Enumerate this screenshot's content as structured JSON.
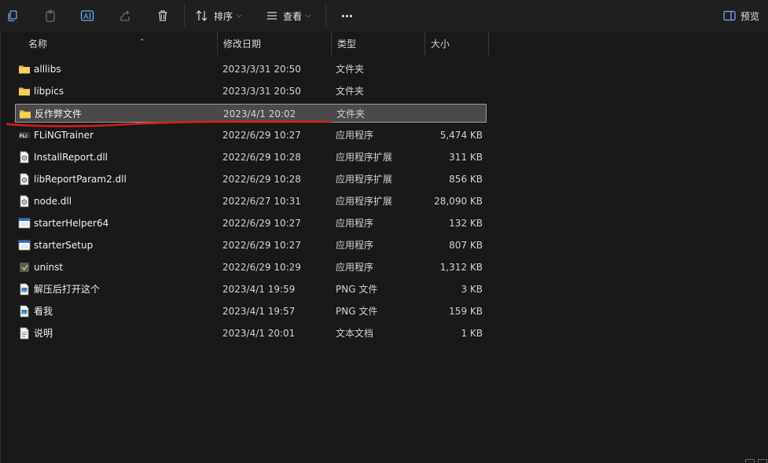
{
  "toolbar": {
    "sort_label": "排序",
    "view_label": "查看",
    "more_label": "···",
    "preview_label": "预览"
  },
  "columns": {
    "name": "名称",
    "date": "修改日期",
    "type": "类型",
    "size": "大小"
  },
  "files": [
    {
      "name": "alllibs",
      "date": "2023/3/31 20:50",
      "type": "文件夹",
      "size": "",
      "icon": "folder-icon"
    },
    {
      "name": "libpics",
      "date": "2023/3/31 20:50",
      "type": "文件夹",
      "size": "",
      "icon": "folder-icon"
    },
    {
      "name": "反作弊文件",
      "date": "2023/4/1 20:02",
      "type": "文件夹",
      "size": "",
      "icon": "folder-icon"
    },
    {
      "name": "FLiNGTrainer",
      "date": "2022/6/29 10:27",
      "type": "应用程序",
      "size": "5,474 KB",
      "icon": "trainer-app-icon"
    },
    {
      "name": "InstallReport.dll",
      "date": "2022/6/29 10:28",
      "type": "应用程序扩展",
      "size": "311 KB",
      "icon": "dll-file-icon"
    },
    {
      "name": "libReportParam2.dll",
      "date": "2022/6/29 10:28",
      "type": "应用程序扩展",
      "size": "856 KB",
      "icon": "dll-file-icon"
    },
    {
      "name": "node.dll",
      "date": "2022/6/27 10:31",
      "type": "应用程序扩展",
      "size": "28,090 KB",
      "icon": "dll-file-icon"
    },
    {
      "name": "starterHelper64",
      "date": "2022/6/29 10:27",
      "type": "应用程序",
      "size": "132 KB",
      "icon": "exe-window-icon"
    },
    {
      "name": "starterSetup",
      "date": "2022/6/29 10:27",
      "type": "应用程序",
      "size": "807 KB",
      "icon": "exe-window-icon"
    },
    {
      "name": "uninst",
      "date": "2022/6/29 10:29",
      "type": "应用程序",
      "size": "1,312 KB",
      "icon": "uninstaller-icon"
    },
    {
      "name": "解压后打开这个",
      "date": "2023/4/1 19:59",
      "type": "PNG 文件",
      "size": "3 KB",
      "icon": "image-file-icon"
    },
    {
      "name": "看我",
      "date": "2023/4/1 19:57",
      "type": "PNG 文件",
      "size": "159 KB",
      "icon": "image-file-icon"
    },
    {
      "name": "说明",
      "date": "2023/4/1 20:01",
      "type": "文本文档",
      "size": "1 KB",
      "icon": "text-file-icon"
    }
  ],
  "selected_index": 2,
  "colors": {
    "background": "#191919",
    "selection": "#4a4a4a",
    "annotation": "#d42020",
    "folder": "#f2c94c"
  }
}
